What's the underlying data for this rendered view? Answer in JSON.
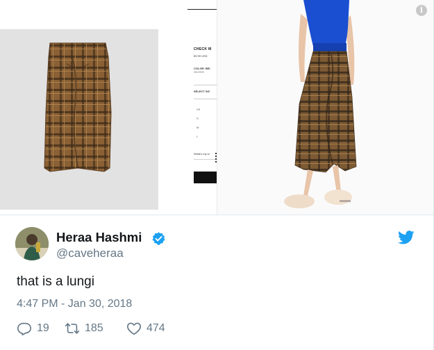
{
  "media": {
    "product_page": {
      "title": "CHECK M",
      "price": "89.90 USD",
      "color_label": "COLOR: BEI",
      "color_code": "0012/078",
      "select_size": "SELECT SIZ",
      "sizes": [
        "XS",
        "S",
        "M",
        "L"
      ],
      "fit_text": "What's my si",
      "partial_heading": "N"
    },
    "info_icon_glyph": "i"
  },
  "tweet": {
    "author_name": "Heraa Hashmi",
    "handle": "@caveheraa",
    "text": "that is a lungi",
    "timestamp": "4:47 PM - Jan 30, 2018",
    "reply_count": "19",
    "retweet_count": "185",
    "like_count": "474"
  },
  "icons": {
    "verified": "verified-badge-icon",
    "brand": "twitter-bird-icon",
    "reply": "reply-icon",
    "retweet": "retweet-icon",
    "like": "heart-icon",
    "info": "info-icon"
  },
  "colors": {
    "twitter_blue": "#1da1f2",
    "muted_text": "#657786",
    "plaid_brown": "#8a6034",
    "sweater_blue": "#1a4fd1"
  }
}
